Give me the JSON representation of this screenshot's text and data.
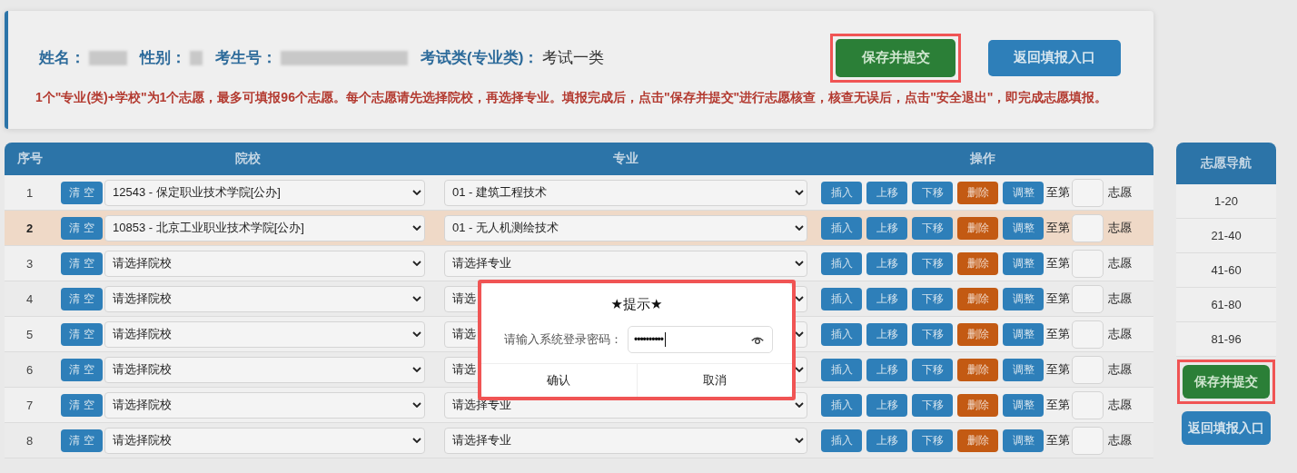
{
  "header": {
    "fields": [
      {
        "label": "姓名：",
        "kind": "redacted"
      },
      {
        "label": "性别：",
        "kind": "redacted"
      },
      {
        "label": "考生号：",
        "kind": "redacted"
      },
      {
        "label": "考试类(专业类)：",
        "kind": "text",
        "value": "考试一类"
      }
    ],
    "save_button": {
      "label": "保存并提交",
      "highlighted": true
    },
    "return_button": {
      "label": "返回填报入口"
    },
    "notice": "1个\"专业(类)+学校\"为1个志愿，最多可填报96个志愿。每个志愿请先选择院校，再选择专业。填报完成后，点击\"保存并提交\"进行志愿核查，核查无误后，点击\"安全退出\"，即完成志愿填报。"
  },
  "table": {
    "columns": [
      "序号",
      "院校",
      "专业",
      "操作"
    ],
    "rows": [
      {
        "number": "1",
        "selected": false,
        "clear": "清 空",
        "school": "12543 - 保定职业技术学院[公办]",
        "major": "01 - 建筑工程技术",
        "actions": [
          {
            "label": "插入",
            "kind": "normal"
          },
          {
            "label": "上移",
            "kind": "normal"
          },
          {
            "label": "下移",
            "kind": "normal"
          },
          {
            "label": "删除",
            "kind": "danger"
          },
          {
            "label": "调整",
            "kind": "normal"
          }
        ],
        "to_label": "至第",
        "suffix": "志愿"
      },
      {
        "number": "2",
        "selected": true,
        "clear": "清 空",
        "school": "10853 - 北京工业职业技术学院[公办]",
        "major": "01 - 无人机测绘技术",
        "actions": [
          {
            "label": "插入",
            "kind": "normal"
          },
          {
            "label": "上移",
            "kind": "normal"
          },
          {
            "label": "下移",
            "kind": "normal"
          },
          {
            "label": "删除",
            "kind": "danger"
          },
          {
            "label": "调整",
            "kind": "normal"
          }
        ],
        "to_label": "至第",
        "suffix": "志愿"
      },
      {
        "number": "3",
        "selected": false,
        "clear": "清 空",
        "school": "请选择院校",
        "major": "请选择专业",
        "actions": [
          {
            "label": "插入",
            "kind": "normal"
          },
          {
            "label": "上移",
            "kind": "normal"
          },
          {
            "label": "下移",
            "kind": "normal"
          },
          {
            "label": "删除",
            "kind": "danger"
          },
          {
            "label": "调整",
            "kind": "normal"
          }
        ],
        "to_label": "至第",
        "suffix": "志愿"
      },
      {
        "number": "4",
        "selected": false,
        "clear": "清 空",
        "school": "请选择院校",
        "major": "请选",
        "actions": [
          {
            "label": "插入",
            "kind": "normal"
          },
          {
            "label": "上移",
            "kind": "normal"
          },
          {
            "label": "下移",
            "kind": "normal"
          },
          {
            "label": "删除",
            "kind": "danger"
          },
          {
            "label": "调整",
            "kind": "normal"
          }
        ],
        "to_label": "至第",
        "suffix": "志愿"
      },
      {
        "number": "5",
        "selected": false,
        "clear": "清 空",
        "school": "请选择院校",
        "major": "请选",
        "actions": [
          {
            "label": "插入",
            "kind": "normal"
          },
          {
            "label": "上移",
            "kind": "normal"
          },
          {
            "label": "下移",
            "kind": "normal"
          },
          {
            "label": "删除",
            "kind": "danger"
          },
          {
            "label": "调整",
            "kind": "normal"
          }
        ],
        "to_label": "至第",
        "suffix": "志愿"
      },
      {
        "number": "6",
        "selected": false,
        "clear": "清 空",
        "school": "请选择院校",
        "major": "请选",
        "actions": [
          {
            "label": "插入",
            "kind": "normal"
          },
          {
            "label": "上移",
            "kind": "normal"
          },
          {
            "label": "下移",
            "kind": "normal"
          },
          {
            "label": "删除",
            "kind": "danger"
          },
          {
            "label": "调整",
            "kind": "normal"
          }
        ],
        "to_label": "至第",
        "suffix": "志愿"
      },
      {
        "number": "7",
        "selected": false,
        "clear": "清 空",
        "school": "请选择院校",
        "major": "请选择专业",
        "actions": [
          {
            "label": "插入",
            "kind": "normal"
          },
          {
            "label": "上移",
            "kind": "normal"
          },
          {
            "label": "下移",
            "kind": "normal"
          },
          {
            "label": "删除",
            "kind": "danger"
          },
          {
            "label": "调整",
            "kind": "normal"
          }
        ],
        "to_label": "至第",
        "suffix": "志愿"
      },
      {
        "number": "8",
        "selected": false,
        "clear": "清 空",
        "school": "请选择院校",
        "major": "请选择专业",
        "actions": [
          {
            "label": "插入",
            "kind": "normal"
          },
          {
            "label": "上移",
            "kind": "normal"
          },
          {
            "label": "下移",
            "kind": "normal"
          },
          {
            "label": "删除",
            "kind": "danger"
          },
          {
            "label": "调整",
            "kind": "normal"
          }
        ],
        "to_label": "至第",
        "suffix": "志愿"
      }
    ]
  },
  "navigation": {
    "title": "志愿导航",
    "items": [
      "1-20",
      "21-40",
      "41-60",
      "61-80",
      "81-96"
    ],
    "save_button": {
      "label": "保存并提交",
      "highlighted": true
    },
    "return_button": {
      "label": "返回填报入口"
    }
  },
  "dialog": {
    "title": "★提示★",
    "highlighted": true,
    "label": "请输入系统登录密码：",
    "password": "••••••••••",
    "buttons": [
      "确认",
      "取消"
    ]
  }
}
